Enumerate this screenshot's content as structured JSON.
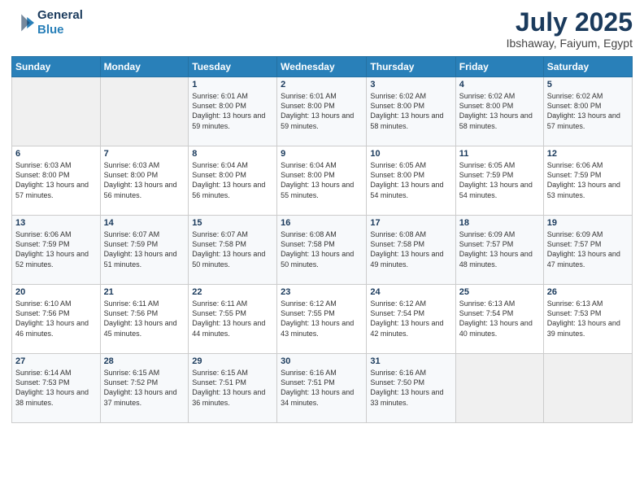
{
  "header": {
    "logo_line1": "General",
    "logo_line2": "Blue",
    "title": "July 2025",
    "subtitle": "Ibshaway, Faiyum, Egypt"
  },
  "days_of_week": [
    "Sunday",
    "Monday",
    "Tuesday",
    "Wednesday",
    "Thursday",
    "Friday",
    "Saturday"
  ],
  "weeks": [
    [
      {
        "num": "",
        "sunrise": "",
        "sunset": "",
        "daylight": ""
      },
      {
        "num": "",
        "sunrise": "",
        "sunset": "",
        "daylight": ""
      },
      {
        "num": "1",
        "sunrise": "Sunrise: 6:01 AM",
        "sunset": "Sunset: 8:00 PM",
        "daylight": "Daylight: 13 hours and 59 minutes."
      },
      {
        "num": "2",
        "sunrise": "Sunrise: 6:01 AM",
        "sunset": "Sunset: 8:00 PM",
        "daylight": "Daylight: 13 hours and 59 minutes."
      },
      {
        "num": "3",
        "sunrise": "Sunrise: 6:02 AM",
        "sunset": "Sunset: 8:00 PM",
        "daylight": "Daylight: 13 hours and 58 minutes."
      },
      {
        "num": "4",
        "sunrise": "Sunrise: 6:02 AM",
        "sunset": "Sunset: 8:00 PM",
        "daylight": "Daylight: 13 hours and 58 minutes."
      },
      {
        "num": "5",
        "sunrise": "Sunrise: 6:02 AM",
        "sunset": "Sunset: 8:00 PM",
        "daylight": "Daylight: 13 hours and 57 minutes."
      }
    ],
    [
      {
        "num": "6",
        "sunrise": "Sunrise: 6:03 AM",
        "sunset": "Sunset: 8:00 PM",
        "daylight": "Daylight: 13 hours and 57 minutes."
      },
      {
        "num": "7",
        "sunrise": "Sunrise: 6:03 AM",
        "sunset": "Sunset: 8:00 PM",
        "daylight": "Daylight: 13 hours and 56 minutes."
      },
      {
        "num": "8",
        "sunrise": "Sunrise: 6:04 AM",
        "sunset": "Sunset: 8:00 PM",
        "daylight": "Daylight: 13 hours and 56 minutes."
      },
      {
        "num": "9",
        "sunrise": "Sunrise: 6:04 AM",
        "sunset": "Sunset: 8:00 PM",
        "daylight": "Daylight: 13 hours and 55 minutes."
      },
      {
        "num": "10",
        "sunrise": "Sunrise: 6:05 AM",
        "sunset": "Sunset: 8:00 PM",
        "daylight": "Daylight: 13 hours and 54 minutes."
      },
      {
        "num": "11",
        "sunrise": "Sunrise: 6:05 AM",
        "sunset": "Sunset: 7:59 PM",
        "daylight": "Daylight: 13 hours and 54 minutes."
      },
      {
        "num": "12",
        "sunrise": "Sunrise: 6:06 AM",
        "sunset": "Sunset: 7:59 PM",
        "daylight": "Daylight: 13 hours and 53 minutes."
      }
    ],
    [
      {
        "num": "13",
        "sunrise": "Sunrise: 6:06 AM",
        "sunset": "Sunset: 7:59 PM",
        "daylight": "Daylight: 13 hours and 52 minutes."
      },
      {
        "num": "14",
        "sunrise": "Sunrise: 6:07 AM",
        "sunset": "Sunset: 7:59 PM",
        "daylight": "Daylight: 13 hours and 51 minutes."
      },
      {
        "num": "15",
        "sunrise": "Sunrise: 6:07 AM",
        "sunset": "Sunset: 7:58 PM",
        "daylight": "Daylight: 13 hours and 50 minutes."
      },
      {
        "num": "16",
        "sunrise": "Sunrise: 6:08 AM",
        "sunset": "Sunset: 7:58 PM",
        "daylight": "Daylight: 13 hours and 50 minutes."
      },
      {
        "num": "17",
        "sunrise": "Sunrise: 6:08 AM",
        "sunset": "Sunset: 7:58 PM",
        "daylight": "Daylight: 13 hours and 49 minutes."
      },
      {
        "num": "18",
        "sunrise": "Sunrise: 6:09 AM",
        "sunset": "Sunset: 7:57 PM",
        "daylight": "Daylight: 13 hours and 48 minutes."
      },
      {
        "num": "19",
        "sunrise": "Sunrise: 6:09 AM",
        "sunset": "Sunset: 7:57 PM",
        "daylight": "Daylight: 13 hours and 47 minutes."
      }
    ],
    [
      {
        "num": "20",
        "sunrise": "Sunrise: 6:10 AM",
        "sunset": "Sunset: 7:56 PM",
        "daylight": "Daylight: 13 hours and 46 minutes."
      },
      {
        "num": "21",
        "sunrise": "Sunrise: 6:11 AM",
        "sunset": "Sunset: 7:56 PM",
        "daylight": "Daylight: 13 hours and 45 minutes."
      },
      {
        "num": "22",
        "sunrise": "Sunrise: 6:11 AM",
        "sunset": "Sunset: 7:55 PM",
        "daylight": "Daylight: 13 hours and 44 minutes."
      },
      {
        "num": "23",
        "sunrise": "Sunrise: 6:12 AM",
        "sunset": "Sunset: 7:55 PM",
        "daylight": "Daylight: 13 hours and 43 minutes."
      },
      {
        "num": "24",
        "sunrise": "Sunrise: 6:12 AM",
        "sunset": "Sunset: 7:54 PM",
        "daylight": "Daylight: 13 hours and 42 minutes."
      },
      {
        "num": "25",
        "sunrise": "Sunrise: 6:13 AM",
        "sunset": "Sunset: 7:54 PM",
        "daylight": "Daylight: 13 hours and 40 minutes."
      },
      {
        "num": "26",
        "sunrise": "Sunrise: 6:13 AM",
        "sunset": "Sunset: 7:53 PM",
        "daylight": "Daylight: 13 hours and 39 minutes."
      }
    ],
    [
      {
        "num": "27",
        "sunrise": "Sunrise: 6:14 AM",
        "sunset": "Sunset: 7:53 PM",
        "daylight": "Daylight: 13 hours and 38 minutes."
      },
      {
        "num": "28",
        "sunrise": "Sunrise: 6:15 AM",
        "sunset": "Sunset: 7:52 PM",
        "daylight": "Daylight: 13 hours and 37 minutes."
      },
      {
        "num": "29",
        "sunrise": "Sunrise: 6:15 AM",
        "sunset": "Sunset: 7:51 PM",
        "daylight": "Daylight: 13 hours and 36 minutes."
      },
      {
        "num": "30",
        "sunrise": "Sunrise: 6:16 AM",
        "sunset": "Sunset: 7:51 PM",
        "daylight": "Daylight: 13 hours and 34 minutes."
      },
      {
        "num": "31",
        "sunrise": "Sunrise: 6:16 AM",
        "sunset": "Sunset: 7:50 PM",
        "daylight": "Daylight: 13 hours and 33 minutes."
      },
      {
        "num": "",
        "sunrise": "",
        "sunset": "",
        "daylight": ""
      },
      {
        "num": "",
        "sunrise": "",
        "sunset": "",
        "daylight": ""
      }
    ]
  ]
}
